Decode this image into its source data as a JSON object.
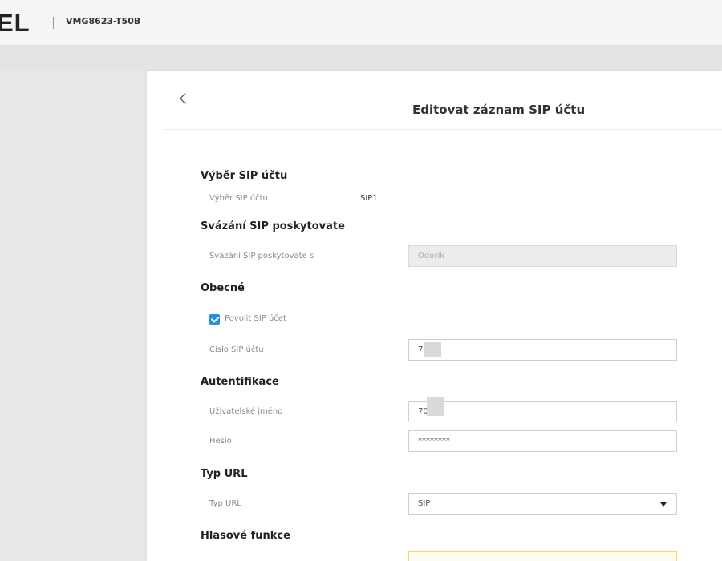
{
  "header": {
    "logo": "EL",
    "model": "VMG8623-T50B"
  },
  "panel": {
    "title": "Editovat záznam SIP účtu"
  },
  "sections": {
    "sip_account": {
      "heading": "Výběr SIP účtu",
      "label": "Výběr SIP účtu",
      "value": "SIP1"
    },
    "provider_binding": {
      "heading": "Svázání SIP poskytovate",
      "label": "Svázání SIP poskytovate s",
      "value": "Odorik"
    },
    "general": {
      "heading": "Obecné",
      "enable_label": "Povolit SIP účet",
      "enable_checked": true,
      "number_label": "Číslo SIP účtu",
      "number_value": "70     58"
    },
    "auth": {
      "heading": "Autentifikace",
      "username_label": "Uživatelské jméno",
      "username_value": "70     8",
      "password_label": "Heslo",
      "password_value": "********"
    },
    "url_type": {
      "heading": "Typ URL",
      "label": "Typ URL",
      "value": "SIP"
    },
    "voice": {
      "heading": "Hlasové funkce"
    }
  },
  "colors": {
    "accent": "#2a8fd8",
    "focus_border": "#f0d86a"
  }
}
